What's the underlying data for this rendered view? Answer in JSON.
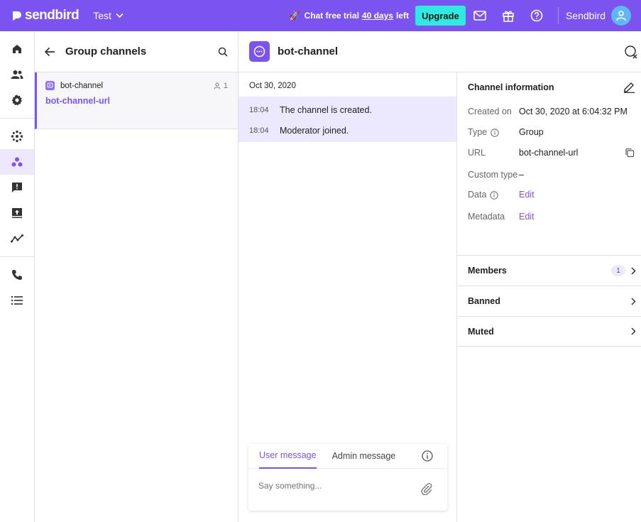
{
  "topbar": {
    "brand": "sendbird",
    "app_name": "Test",
    "trial_prefix": "Chat free trial",
    "trial_days": "40 days",
    "trial_suffix": "left",
    "upgrade_label": "Upgrade",
    "org_name": "Sendbird",
    "icons": [
      "mail-icon",
      "gift-icon",
      "help-icon"
    ],
    "accent": "#7b53ef"
  },
  "nav": {
    "items": [
      "home-icon",
      "users-icon",
      "settings-icon",
      "open-channels-icon",
      "group-channels-icon",
      "moderation-icon",
      "announcements-icon",
      "analytics-icon",
      "calls-icon",
      "call-logs-icon"
    ],
    "active": "group-channels-icon"
  },
  "channel_list": {
    "title": "Group channels",
    "channels": [
      {
        "name": "bot-channel",
        "member_count": "1",
        "url": "bot-channel-url"
      }
    ]
  },
  "chat": {
    "channel_name": "bot-channel",
    "date": "Oct 30, 2020",
    "messages": [
      {
        "time": "18:04",
        "text": "The channel is created."
      },
      {
        "time": "18:04",
        "text": "Moderator joined."
      }
    ],
    "composer": {
      "tab_user": "User message",
      "tab_admin": "Admin message",
      "placeholder": "Say something..."
    }
  },
  "info": {
    "title": "Channel information",
    "created_on_label": "Created on",
    "created_on": "Oct 30, 2020 at 6:04:32 PM",
    "type_label": "Type",
    "type": "Group",
    "url_label": "URL",
    "url": "bot-channel-url",
    "custom_type_label": "Custom type",
    "custom_type": "–",
    "data_label": "Data",
    "data_action": "Edit",
    "metadata_label": "Metadata",
    "metadata_action": "Edit",
    "sections": {
      "members": "Members",
      "members_count": "1",
      "banned": "Banned",
      "muted": "Muted"
    }
  }
}
